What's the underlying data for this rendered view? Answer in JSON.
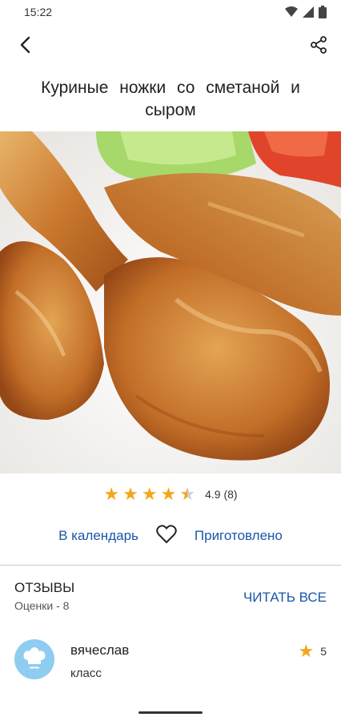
{
  "status_bar": {
    "time": "15:22"
  },
  "recipe": {
    "title": "Куриные ножки со сметаной и сыром"
  },
  "rating": {
    "value": 4.5,
    "text": "4.9 (8)"
  },
  "actions": {
    "calendar": "В календарь",
    "cooked": "Приготовлено"
  },
  "reviews": {
    "title": "ОТЗЫВЫ",
    "subtitle": "Оценки - 8",
    "read_all": "ЧИТАТЬ ВСЕ",
    "items": [
      {
        "name": "вячеслав",
        "text": "класс",
        "score": "5"
      }
    ]
  },
  "colors": {
    "accent": "#1a57a8",
    "star": "#f5a51b",
    "avatar": "#8ecdf0"
  }
}
